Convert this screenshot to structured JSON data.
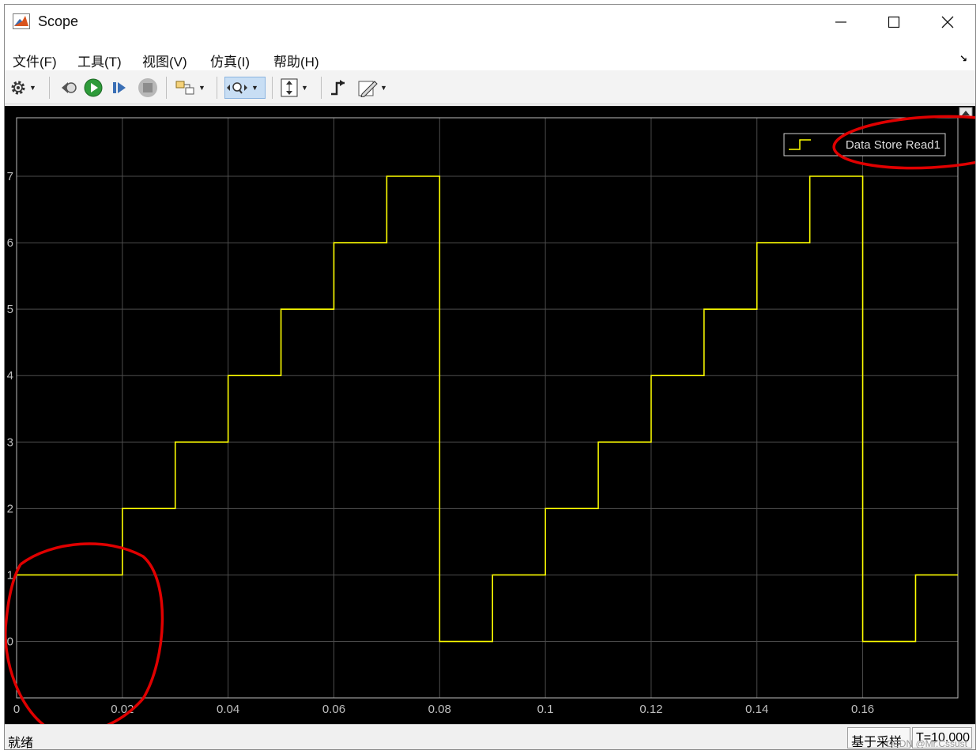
{
  "window": {
    "title": "Scope"
  },
  "menu": {
    "items": [
      "文件(F)",
      "工具(T)",
      "视图(V)",
      "仿真(I)",
      "帮助(H)"
    ],
    "undock_glyph": "↘"
  },
  "toolbar": {
    "icons": [
      "gear-icon",
      "step-back-icon",
      "run-icon",
      "step-forward-icon",
      "stop-icon",
      "highlight-block-icon",
      "zoom-icon",
      "scale-axes-icon",
      "triggers-icon",
      "edit-icon"
    ]
  },
  "status": {
    "left": "就绪",
    "mode": "基于采样",
    "time": "T=10.000",
    "watermark": "CSDN @Mr.Cssust"
  },
  "chart_data": {
    "type": "line",
    "step": true,
    "xlim": [
      0,
      0.178
    ],
    "ylim": [
      -0.85,
      7.88
    ],
    "x_ticks": [
      0,
      0.02,
      0.04,
      0.06,
      0.08,
      0.1,
      0.12,
      0.14,
      0.16
    ],
    "x_tick_labels": [
      "0",
      "0.02",
      "0.04",
      "0.06",
      "0.08",
      "0.1",
      "0.12",
      "0.14",
      "0.16"
    ],
    "y_ticks": [
      0,
      1,
      2,
      3,
      4,
      5,
      6,
      7
    ],
    "y_tick_labels": [
      "0",
      "1",
      "2",
      "3",
      "4",
      "5",
      "6",
      "7"
    ],
    "grid": true,
    "legend": "top-right",
    "colors": {
      "background": "#000000",
      "grid": "#4d4d4d",
      "axis": "#bdbdbd",
      "line": "#ffff00",
      "tick_label": "#bfbfbf",
      "annotation": "#e00000"
    },
    "series": [
      {
        "name": "Data Store Read1",
        "x": [
          0,
          0.01,
          0.02,
          0.03,
          0.04,
          0.05,
          0.06,
          0.07,
          0.08,
          0.09,
          0.1,
          0.11,
          0.12,
          0.13,
          0.14,
          0.15,
          0.16,
          0.17,
          0.178
        ],
        "y": [
          1,
          1,
          2,
          3,
          4,
          5,
          6,
          7,
          0,
          1,
          2,
          3,
          4,
          5,
          6,
          7,
          0,
          1,
          1
        ]
      }
    ]
  }
}
